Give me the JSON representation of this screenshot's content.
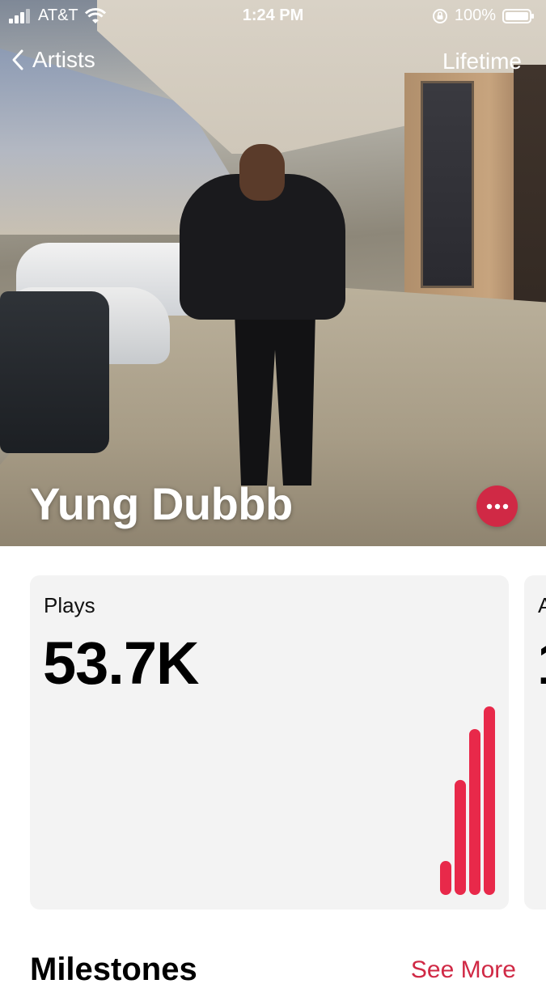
{
  "status_bar": {
    "carrier": "AT&T",
    "time": "1:24 PM",
    "battery": "100%",
    "icons": [
      "signal-icon",
      "wifi-icon",
      "orientation-lock-icon",
      "battery-icon"
    ]
  },
  "nav": {
    "back_label": "Artists",
    "right_label": "Lifetime"
  },
  "artist": {
    "name": "Yung Dubbb"
  },
  "plays_card": {
    "label": "Plays",
    "value": "53.7K",
    "bars": [
      0.18,
      0.61,
      0.88,
      1.0
    ],
    "bar_color": "#e8294a"
  },
  "next_card": {
    "label_peek": "A",
    "value_peek": "1"
  },
  "milestones": {
    "title": "Milestones",
    "see_more": "See More"
  },
  "colors": {
    "accent": "#d02945",
    "card_background": "#f3f3f3"
  }
}
